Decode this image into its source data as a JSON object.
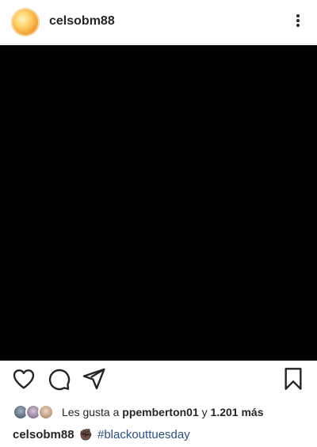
{
  "post": {
    "username": "celsobm88",
    "media_color": "#000000"
  },
  "likes": {
    "prefix": "Les gusta a",
    "first_liker": "ppemberton01",
    "connector": "y",
    "others": "1.201 más"
  },
  "caption": {
    "username": "celsobm88",
    "emoji": "✊🏿",
    "hashtag": "#blackouttuesday"
  },
  "icons": {
    "header_right": "more-vertical-icon",
    "actions": [
      "heart-icon",
      "comment-icon",
      "share-icon"
    ],
    "save": "bookmark-icon"
  }
}
